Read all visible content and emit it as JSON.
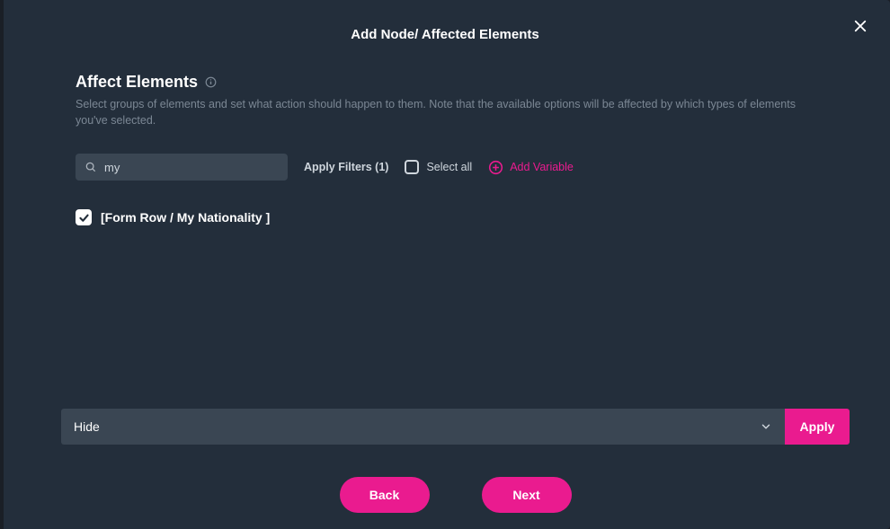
{
  "modal": {
    "title": "Add Node/ Affected Elements"
  },
  "section": {
    "title": "Affect Elements",
    "description": "Select groups of elements and set what action should happen to them. Note that the available options will be affected by which types of elements you've selected."
  },
  "search": {
    "value": "my"
  },
  "filters": {
    "apply_label": "Apply Filters (1)",
    "select_all_label": "Select all",
    "add_variable_label": "Add Variable"
  },
  "results": [
    {
      "checked": true,
      "label": "[Form Row / My Nationality ]"
    }
  ],
  "action": {
    "selected": "Hide",
    "apply_label": "Apply"
  },
  "nav": {
    "back_label": "Back",
    "next_label": "Next"
  }
}
